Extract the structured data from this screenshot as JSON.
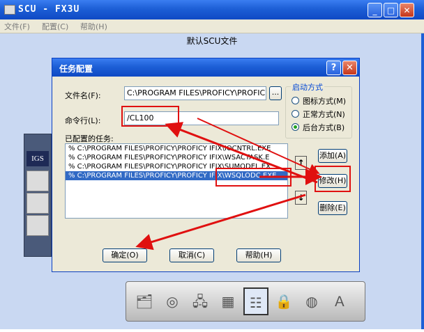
{
  "window": {
    "title": "SCU - FX3U"
  },
  "menu": {
    "file": "文件(F)",
    "config": "配置(C)",
    "help": "帮助(H)"
  },
  "client": {
    "title": "默认SCU文件"
  },
  "device": {
    "label": "IGS"
  },
  "dialog": {
    "title": "任务配置",
    "filename_label": "文件名(F):",
    "filename_value": "C:\\PROGRAM FILES\\PROFICY\\PROFIC",
    "browse_label": "...",
    "command_label": "命令行(L):",
    "command_value": "/CL100",
    "configured_label": "已配置的任务:",
    "tasks": [
      "% C:\\PROGRAM FILES\\PROFICY\\PROFICY IFIX\\IOCNTRL.EXE",
      "% C:\\PROGRAM FILES\\PROFICY\\PROFICY IFIX\\WSACTASK.E",
      "% C:\\PROGRAM FILES\\PROFICY\\PROFICY IFIX\\SUMQDEL.EX",
      "% C:\\PROGRAM FILES\\PROFICY\\PROFICY IFIX\\WSQLODC.EXE"
    ],
    "startup_group": "启动方式",
    "radio_icon": "图标方式(M)",
    "radio_normal": "正常方式(N)",
    "radio_background": "后台方式(B)",
    "add_button": "添加(A)",
    "modify_button": "修改(H)",
    "delete_button": "删除(E)",
    "ok_button": "确定(O)",
    "cancel_button": "取消(C)",
    "help_button": "帮助(H)"
  },
  "colors": {
    "annotation": "#e01010",
    "titlebar": "#1d5fd6",
    "selection": "#316ac5"
  }
}
